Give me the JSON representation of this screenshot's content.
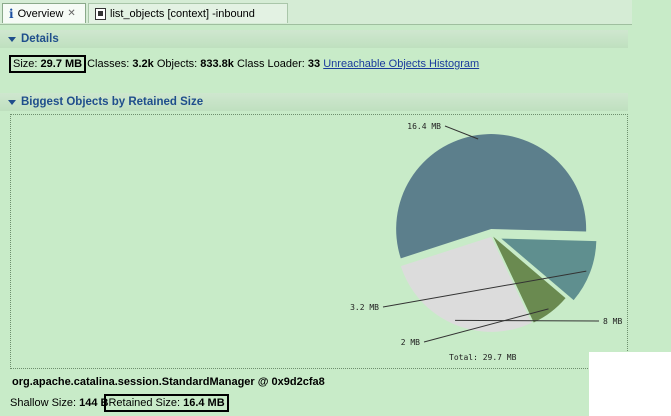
{
  "tabs": {
    "overview_label": "Overview",
    "overview_close": "✕",
    "query_label": "list_objects [context] -inbound"
  },
  "details": {
    "header": "Details",
    "size_label": "Size:",
    "size_value": "29.7 MB",
    "classes_label": "Classes:",
    "classes_value": "3.2k",
    "objects_label": "Objects:",
    "objects_value": "833.8k",
    "classloader_label": "Class Loader:",
    "classloader_value": "33",
    "unreachable_link": "Unreachable Objects Histogram"
  },
  "biggest": {
    "header": "Biggest Objects by Retained Size",
    "selected_object": "org.apache.catalina.session.StandardManager @ 0x9d2cfa8",
    "shallow_label": "Shallow Size:",
    "shallow_value": "144 B",
    "retained_label": "Retained Size:",
    "retained_value": "16.4 MB"
  },
  "chart_data": {
    "type": "pie",
    "unit": "MB",
    "slices": [
      {
        "label": "16.4 MB",
        "value": 16.4,
        "color": "#5c7f8c"
      },
      {
        "label": "8 MB",
        "value": 8.0,
        "color": "#dcdcdc"
      },
      {
        "label": "2 MB",
        "value": 2.0,
        "color": "#6a8a50"
      },
      {
        "label": "3.2 MB",
        "value": 3.2,
        "color": "#5f8f8f"
      }
    ],
    "total_label": "Total: 29.7 MB"
  },
  "colors": {
    "background": "#c8ebc8",
    "header_text": "#1f4e8c",
    "link": "#1a3b9c"
  }
}
